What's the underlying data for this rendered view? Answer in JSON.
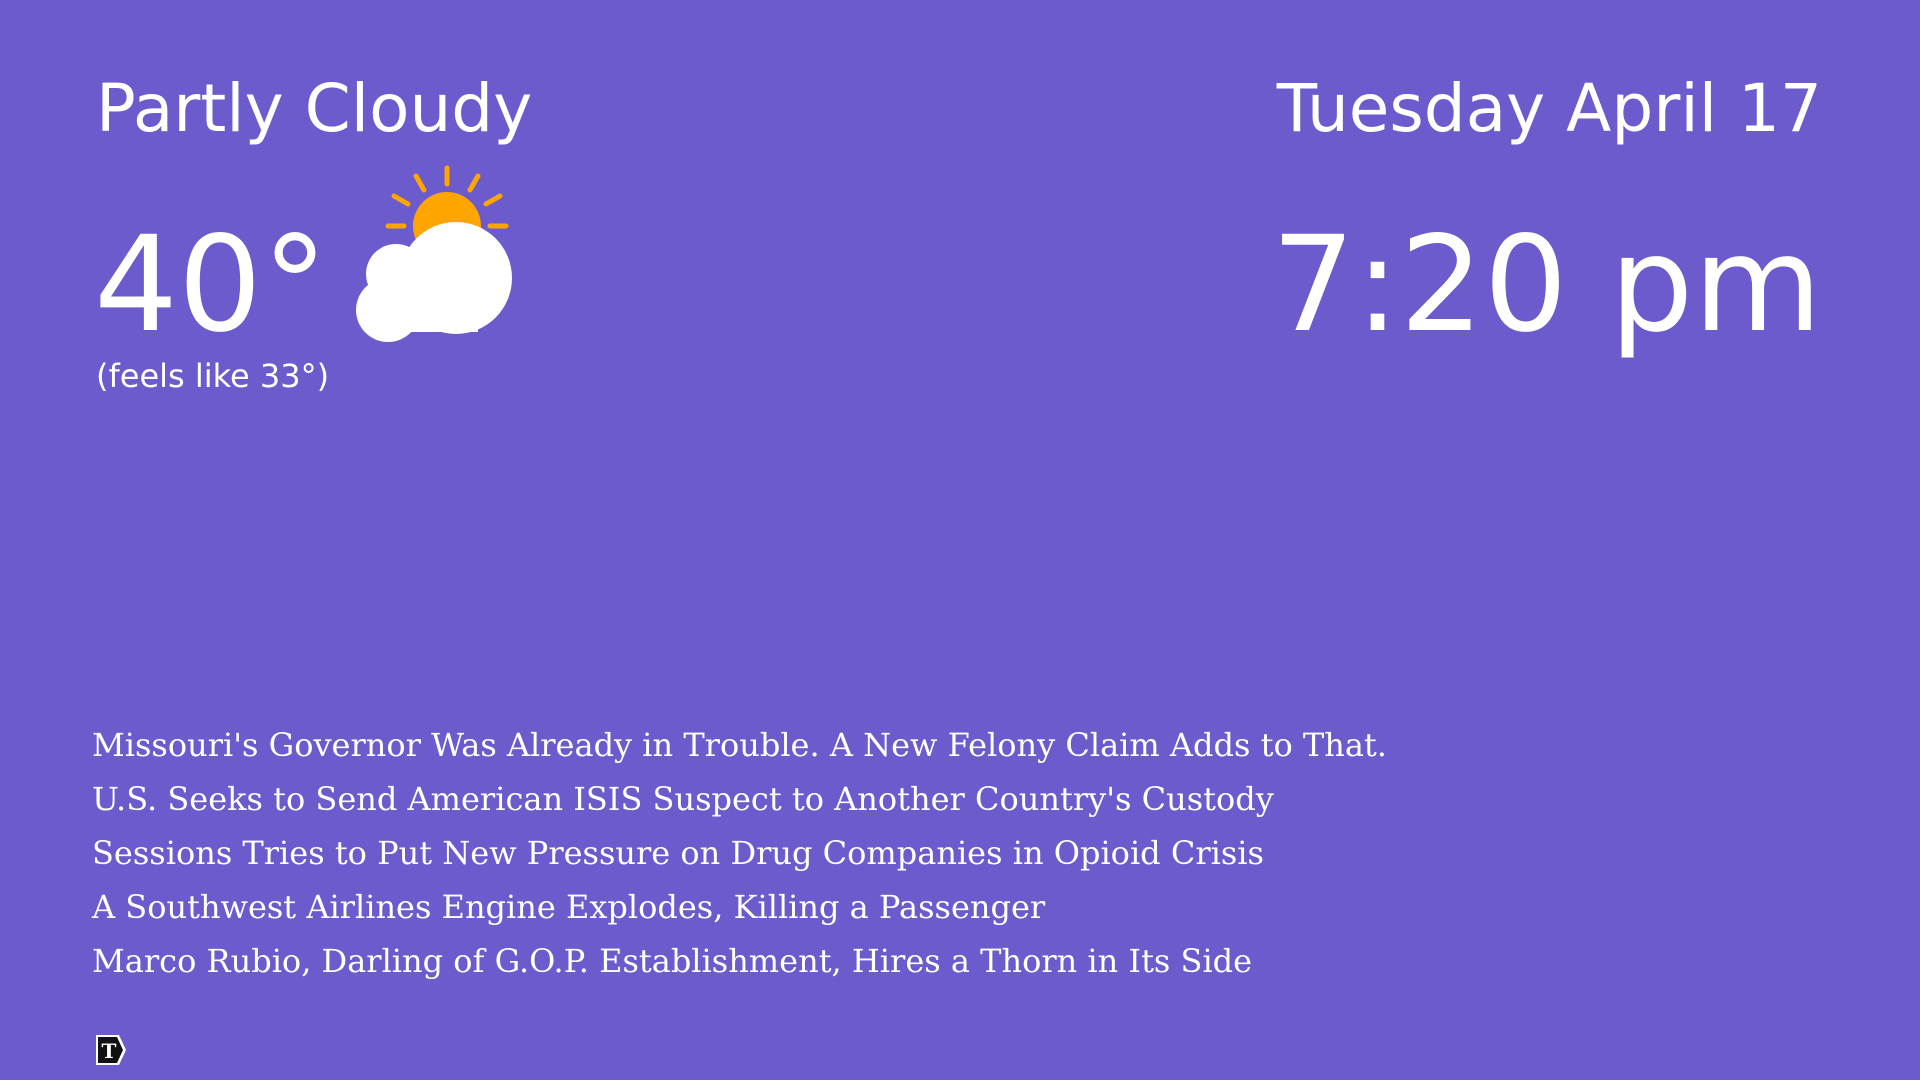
{
  "weather": {
    "condition": "Partly Cloudy",
    "temperature": "40°",
    "feels_like": "(feels like 33°)",
    "icon": "partly-cloudy-icon"
  },
  "clock": {
    "date": "Tuesday April 17",
    "time": "7:20 pm"
  },
  "news": {
    "headlines": [
      "Missouri's Governor Was Already in Trouble. A New Felony Claim Adds to That.",
      "U.S. Seeks to Send American ISIS Suspect to Another Country's Custody",
      "Sessions Tries to Put New Pressure on Drug Companies in Opioid Crisis",
      "A Southwest Airlines Engine Explodes, Killing a Passenger",
      "Marco Rubio, Darling of G.O.P. Establishment, Hires a Thorn in Its Side"
    ],
    "source_icon": "nyt-logo-icon"
  },
  "colors": {
    "background": "#6b5bcd",
    "text": "#ffffff",
    "sun": "#ffa500",
    "cloud": "#ffffff"
  }
}
